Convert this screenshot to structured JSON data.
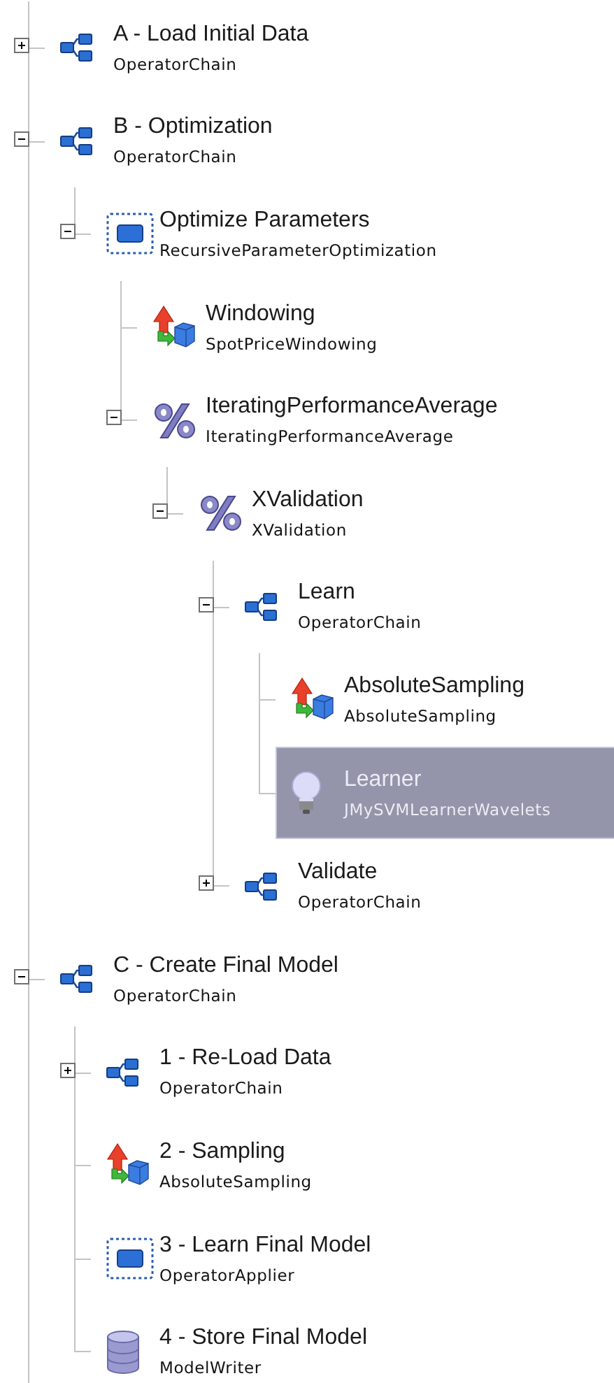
{
  "tree": [
    {
      "title": "A - Load Initial Data",
      "type": "OperatorChain",
      "kind": "chain",
      "expanded": false,
      "selected": false
    },
    {
      "title": "B - Optimization",
      "type": "OperatorChain",
      "kind": "chain",
      "expanded": true,
      "selected": false,
      "children": [
        {
          "title": "Optimize Parameters",
          "type": "RecursiveParameterOptimization",
          "kind": "optimizer",
          "expanded": true,
          "selected": false,
          "children": [
            {
              "title": "Windowing",
              "type": "SpotPriceWindowing",
              "kind": "transform",
              "selected": false
            },
            {
              "title": "IteratingPerformanceAverage",
              "type": "IteratingPerformanceAverage",
              "kind": "percent",
              "expanded": true,
              "selected": false,
              "children": [
                {
                  "title": "XValidation",
                  "type": "XValidation",
                  "kind": "percent",
                  "expanded": true,
                  "selected": false,
                  "children": [
                    {
                      "title": "Learn",
                      "type": "OperatorChain",
                      "kind": "chain",
                      "expanded": true,
                      "selected": false,
                      "children": [
                        {
                          "title": "AbsoluteSampling",
                          "type": "AbsoluteSampling",
                          "kind": "transform",
                          "selected": false
                        },
                        {
                          "title": "Learner",
                          "type": "JMySVMLearnerWavelets",
                          "kind": "learner",
                          "selected": true
                        }
                      ]
                    },
                    {
                      "title": "Validate",
                      "type": "OperatorChain",
                      "kind": "chain",
                      "expanded": false,
                      "selected": false
                    }
                  ]
                }
              ]
            }
          ]
        }
      ]
    },
    {
      "title": "C - Create Final Model",
      "type": "OperatorChain",
      "kind": "chain",
      "expanded": true,
      "selected": false,
      "children": [
        {
          "title": "1 - Re-Load Data",
          "type": "OperatorChain",
          "kind": "chain",
          "expanded": false,
          "selected": false
        },
        {
          "title": "2 - Sampling",
          "type": "AbsoluteSampling",
          "kind": "transform",
          "selected": false
        },
        {
          "title": "3 - Learn Final Model",
          "type": "OperatorApplier",
          "kind": "optimizer",
          "selected": false
        },
        {
          "title": "4 - Store Final Model",
          "type": "ModelWriter",
          "kind": "database",
          "selected": false
        }
      ]
    }
  ]
}
